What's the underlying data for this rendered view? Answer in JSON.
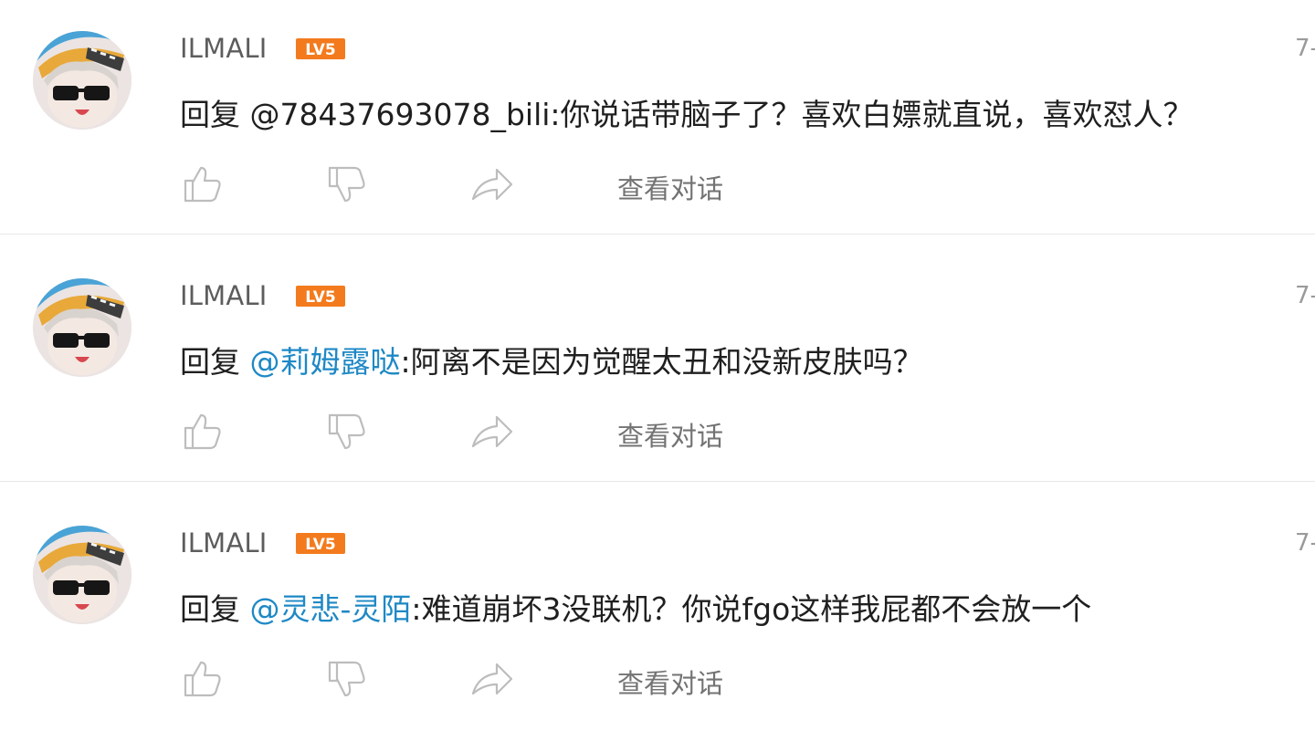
{
  "comments": [
    {
      "username": "ILMALI",
      "level": "LV5",
      "time": "7-",
      "reply_prefix": "回复",
      "mention": "@78437693078_bili",
      "mention_color": "#1f1f1f",
      "text": ":你说话带脑子了？喜欢白嫖就直说，喜欢怼人？",
      "view_label": "查看对话"
    },
    {
      "username": "ILMALI",
      "level": "LV5",
      "time": "7-",
      "reply_prefix": "回复",
      "mention": "@莉姆露哒",
      "mention_color": "#1e88c5",
      "text": ":阿离不是因为觉醒太丑和没新皮肤吗？",
      "view_label": "查看对话"
    },
    {
      "username": "ILMALI",
      "level": "LV5",
      "time": "7-",
      "reply_prefix": "回复",
      "mention": "@灵悲-灵陌",
      "mention_color": "#1e88c5",
      "text": ":难道崩坏3没联机？你说fgo这样我屁都不会放一个",
      "view_label": "查看对话"
    }
  ],
  "icons": {
    "like": "thumbs-up-icon",
    "dislike": "thumbs-down-icon",
    "share": "share-arrow-icon"
  },
  "colors": {
    "level_badge": "#f37b1d",
    "link": "#1e88c5",
    "muted": "#737373"
  }
}
